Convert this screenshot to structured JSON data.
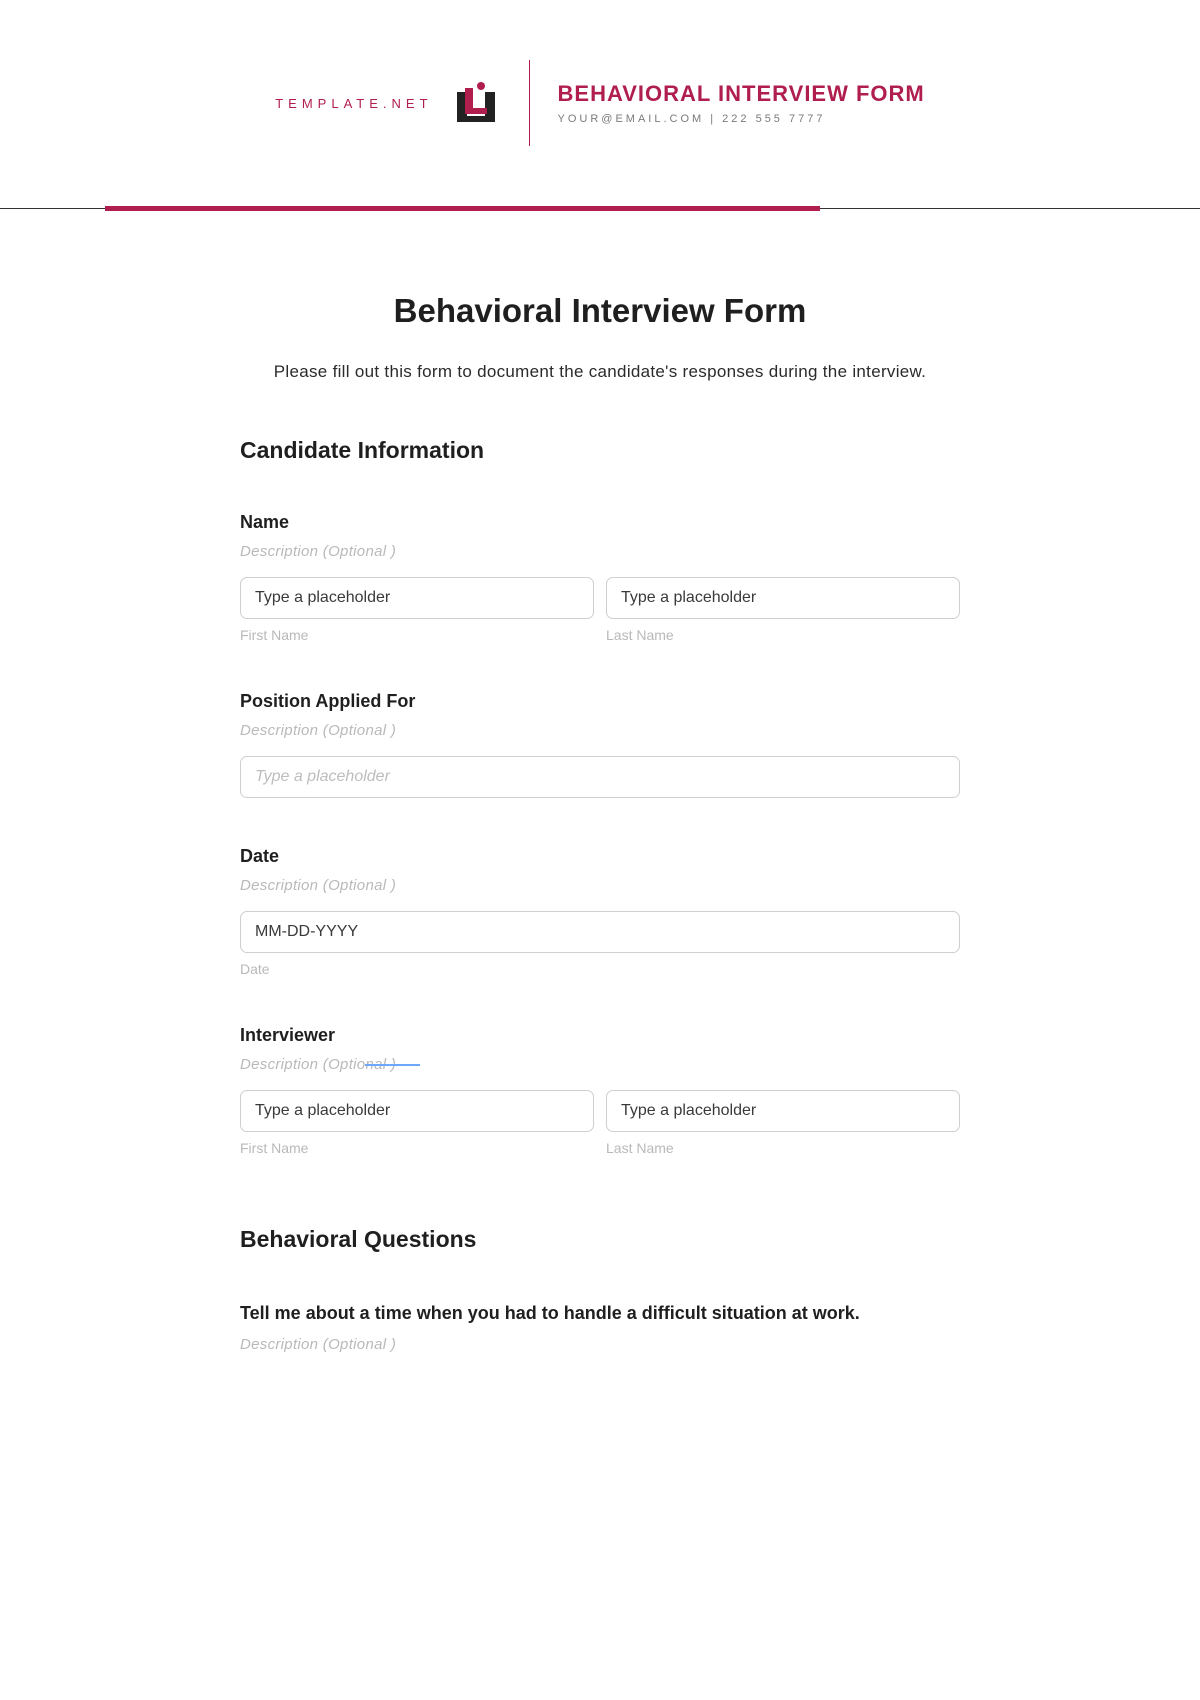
{
  "letterhead": {
    "brand": "TEMPLATE.NET",
    "title": "BEHAVIORAL INTERVIEW FORM",
    "contact": "YOUR@EMAIL.COM | 222 555 7777"
  },
  "form": {
    "title": "Behavioral Interview Form",
    "intro": "Please fill out this form to document the candidate's responses during the interview."
  },
  "sections": {
    "candidate_info": "Candidate Information",
    "behavioral_questions": "Behavioral Questions"
  },
  "fields": {
    "name": {
      "label": "Name",
      "desc": "Description (Optional )",
      "first_placeholder": "Type a placeholder",
      "first_sub": "First Name",
      "last_placeholder": "Type a placeholder",
      "last_sub": "Last Name"
    },
    "position": {
      "label": "Position Applied For",
      "desc": "Description (Optional )",
      "placeholder": "Type a placeholder"
    },
    "date": {
      "label": "Date",
      "desc": "Description (Optional )",
      "placeholder": "MM-DD-YYYY",
      "sub": "Date"
    },
    "interviewer": {
      "label": "Interviewer",
      "desc": "Description (Optional )",
      "first_placeholder": "Type a placeholder",
      "first_sub": "First Name",
      "last_placeholder": "Type a placeholder",
      "last_sub": "Last Name"
    }
  },
  "questions": {
    "q1": {
      "label": "Tell me about a time when you had to handle a difficult situation at work.",
      "desc": "Description (Optional )"
    }
  }
}
